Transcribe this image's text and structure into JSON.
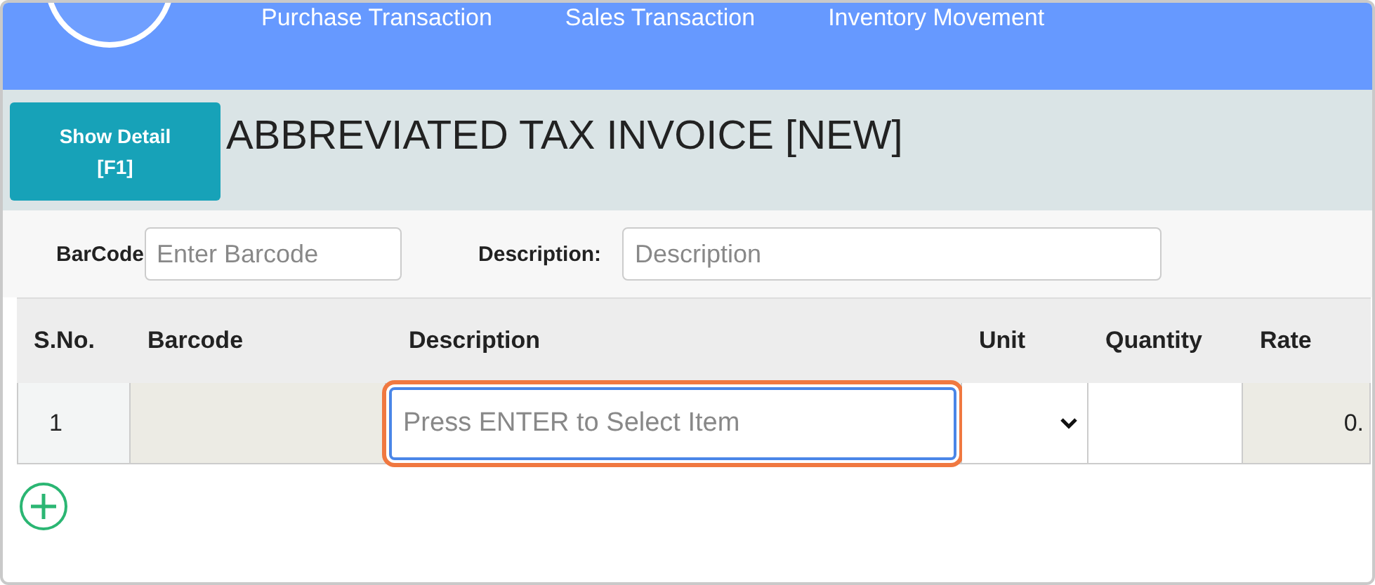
{
  "nav": {
    "items": [
      "Purchase Transaction",
      "Sales Transaction",
      "Inventory Movement"
    ]
  },
  "toolbar": {
    "detail_button": "Show Detail [F1]",
    "title": "ABBREVIATED TAX INVOICE [NEW]"
  },
  "filters": [
    {
      "label": "BarCode",
      "placeholder": "Enter Barcode"
    },
    {
      "label": "Description:",
      "placeholder": "Description"
    }
  ],
  "table": {
    "columns": [
      "S.No.",
      "Barcode",
      "Description",
      "Unit",
      "Quantity",
      "Rate"
    ],
    "rows": [
      {
        "sno": "1",
        "description_placeholder": "Press ENTER to Select Item",
        "focused": true,
        "rate": "0."
      }
    ]
  }
}
